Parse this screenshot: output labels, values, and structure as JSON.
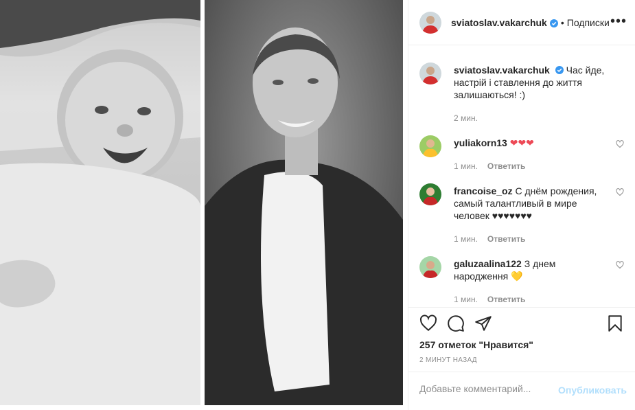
{
  "post": {
    "author": "sviatoslav.vakarchuk",
    "follow_label": "Подписки",
    "separator": "•",
    "more_label": "•••",
    "caption_text": "Час йде, настрій і ставлення до життя залишаються! :)",
    "caption_time": "2 мин.",
    "likes_label": "257 отметок \"Нравится\"",
    "time_ago": "2 МИНУТ НАЗАД"
  },
  "comments": [
    {
      "user": "yuliakorn13",
      "text": "❤❤❤",
      "time": "1 мин.",
      "reply": "Ответить"
    },
    {
      "user": "francoise_oz",
      "text": "С днём рождения, самый талантливый в мире человек ♥♥♥♥♥♥♥",
      "time": "1 мин.",
      "reply": "Ответить"
    },
    {
      "user": "galuzaalina122",
      "text": "З днем народження 💛",
      "time": "1 мин.",
      "reply": "Ответить"
    }
  ],
  "add_comment": {
    "placeholder": "Добавьте комментарий...",
    "publish_label": "Опубликовать"
  },
  "colors": {
    "accent": "#0095f6",
    "publish_disabled": "#b2dffc",
    "muted": "#8e8e8e",
    "heart_red": "#ed4956",
    "verified": "#3897f0"
  },
  "icons": [
    "heart-icon",
    "comment-icon",
    "share-icon",
    "bookmark-icon",
    "verified-icon",
    "more-options-icon"
  ]
}
